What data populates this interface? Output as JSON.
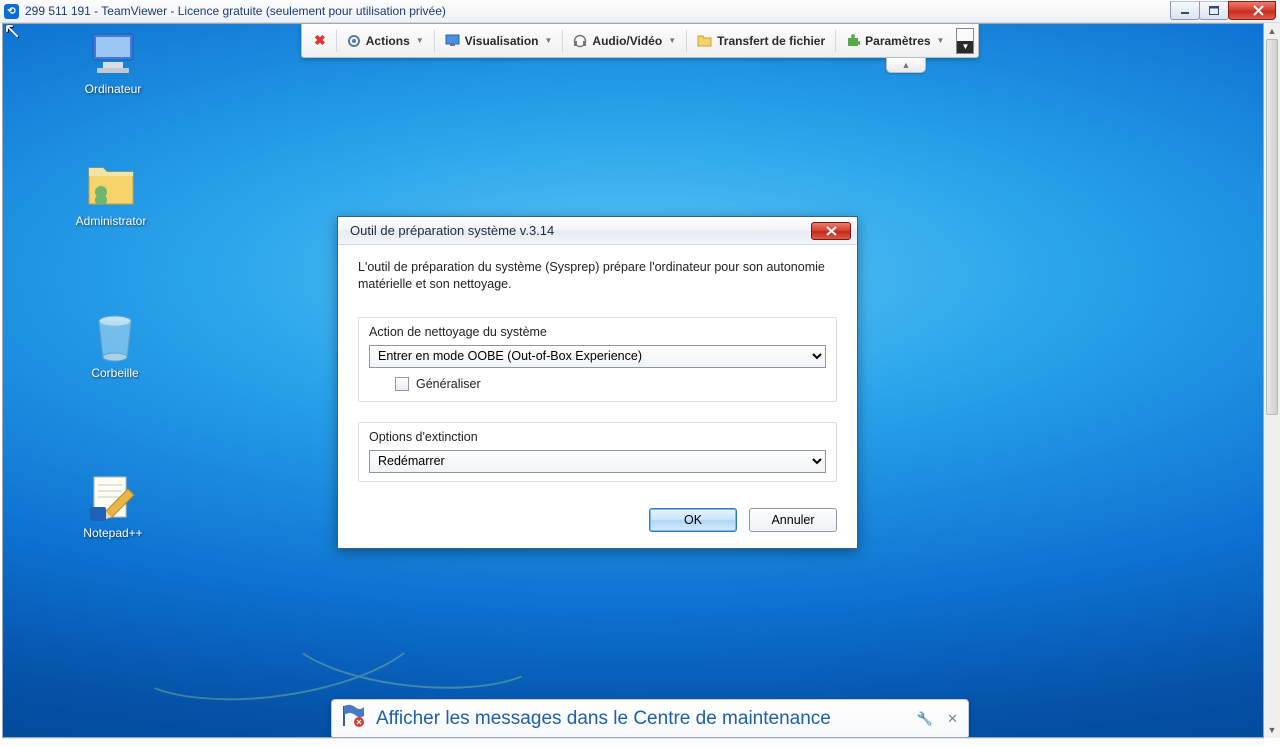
{
  "window": {
    "title": "299 511 191 - TeamViewer - Licence gratuite (seulement pour utilisation privée)"
  },
  "toolbar": {
    "actions": "Actions",
    "visualisation": "Visualisation",
    "audio_video": "Audio/Vidéo",
    "transfert": "Transfert de fichier",
    "parametres": "Paramètres"
  },
  "desktop": {
    "icons": [
      {
        "label": "Ordinateur"
      },
      {
        "label": "Administrator"
      },
      {
        "label": "Corbeille"
      },
      {
        "label": "Notepad++"
      }
    ]
  },
  "dialog": {
    "title": "Outil de préparation système v.3.14",
    "description": "L'outil de préparation du système (Sysprep) prépare l'ordinateur pour son autonomie matérielle et son nettoyage.",
    "group1_legend": "Action de nettoyage du système",
    "group1_select": "Entrer en mode OOBE (Out-of-Box Experience)",
    "generalize": "Généraliser",
    "group2_legend": "Options d'extinction",
    "group2_select": "Redémarrer",
    "ok": "OK",
    "cancel": "Annuler"
  },
  "notification": {
    "message": "Afficher les messages dans le Centre de maintenance"
  }
}
